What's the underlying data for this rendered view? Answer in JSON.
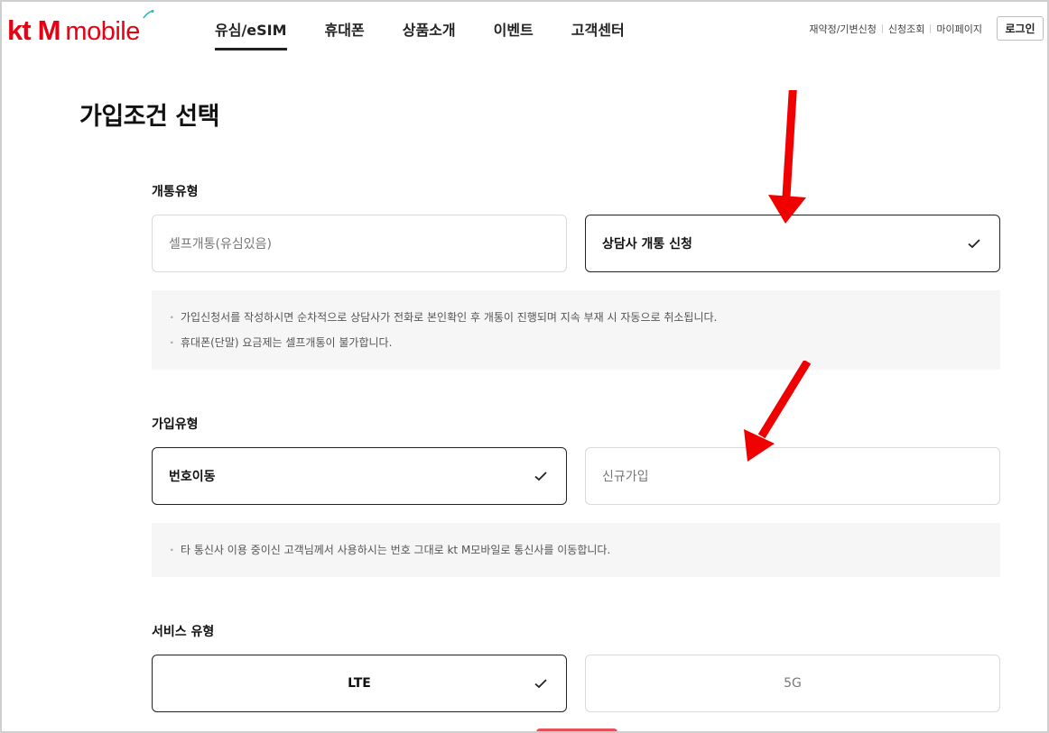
{
  "header": {
    "logo": {
      "kt": "kt",
      "m": "M",
      "mobile": "mobile"
    },
    "nav": [
      {
        "label": "유심/eSIM",
        "active": true
      },
      {
        "label": "휴대폰",
        "active": false
      },
      {
        "label": "상품소개",
        "active": false
      },
      {
        "label": "이벤트",
        "active": false
      },
      {
        "label": "고객센터",
        "active": false
      }
    ],
    "util_links": [
      "재약정/기변신청",
      "신청조회",
      "마이페이지"
    ],
    "login_label": "로그인"
  },
  "page_title": "가입조건 선택",
  "sections": {
    "activation": {
      "label": "개통유형",
      "options": [
        {
          "label": "셀프개통(유심있음)",
          "selected": false
        },
        {
          "label": "상담사 개통 신청",
          "selected": true
        }
      ],
      "notices": [
        "가입신청서를 작성하시면 순차적으로 상담사가 전화로 본인확인 후 개통이 진행되며 지속 부재 시 자동으로 취소됩니다.",
        "휴대폰(단말) 요금제는 셀프개통이 불가합니다."
      ]
    },
    "join": {
      "label": "가입유형",
      "options": [
        {
          "label": "번호이동",
          "selected": true
        },
        {
          "label": "신규가입",
          "selected": false
        }
      ],
      "notices": [
        "타 통신사 이용 중이신 고객님께서 사용하시는 번호 그대로 kt M모바일로 통신사를 이동합니다."
      ]
    },
    "service": {
      "label": "서비스 유형",
      "options": [
        {
          "label": "LTE",
          "selected": true
        },
        {
          "label": "5G",
          "selected": false
        }
      ]
    }
  },
  "colors": {
    "brand": "#e60012",
    "annotation_arrow": "#f00000",
    "notice_bg": "#f6f6f6"
  }
}
